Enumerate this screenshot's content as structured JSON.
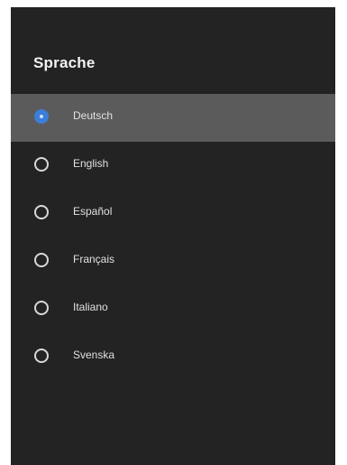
{
  "panel": {
    "title": "Sprache"
  },
  "languages": [
    {
      "label": "Deutsch",
      "selected": true
    },
    {
      "label": "English",
      "selected": false
    },
    {
      "label": "Español",
      "selected": false
    },
    {
      "label": "Français",
      "selected": false
    },
    {
      "label": "Italiano",
      "selected": false
    },
    {
      "label": "Svenska",
      "selected": false
    }
  ],
  "colors": {
    "panel_bg": "#232323",
    "selected_row_bg": "#5b5b5b",
    "radio_checked": "#3b7fd9",
    "text": "#e0e0e0"
  },
  "icons": {
    "radio_selected": "radio-checked-icon",
    "radio_unselected": "radio-unchecked-icon"
  }
}
